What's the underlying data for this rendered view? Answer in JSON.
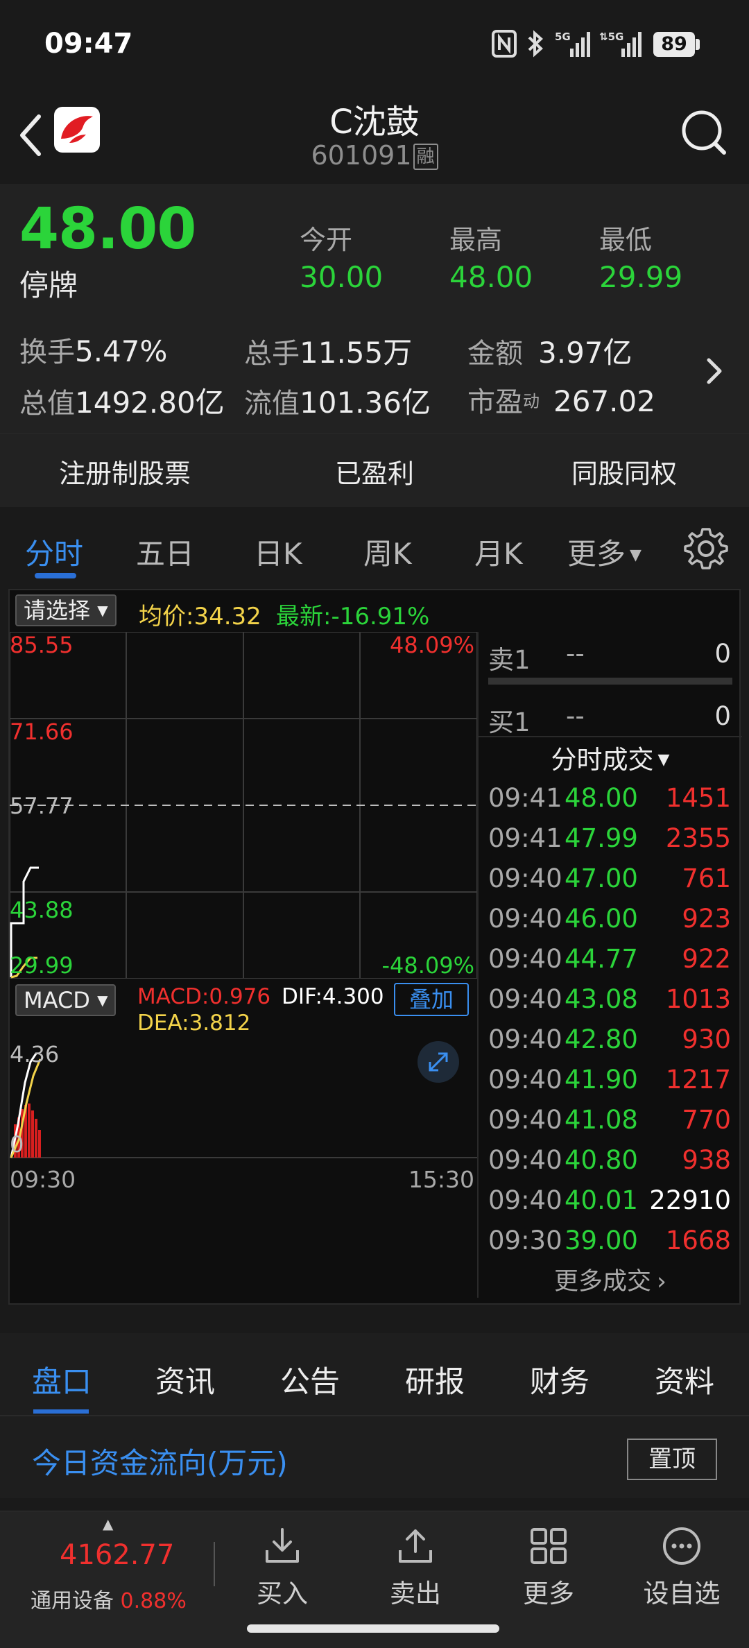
{
  "status_bar": {
    "time": "09:47",
    "battery": "89"
  },
  "header": {
    "name": "C沈鼓",
    "code": "601091",
    "badge": "融"
  },
  "quote": {
    "price": "48.00",
    "status": "停牌",
    "open_label": "今开",
    "open": "30.00",
    "high_label": "最高",
    "high": "48.00",
    "low_label": "最低",
    "low": "29.99",
    "turnover_label": "换手",
    "turnover": "5.47%",
    "volume_label": "总手",
    "volume": "11.55万",
    "amount_label": "金额",
    "amount": "3.97亿",
    "mktcap_label": "总值",
    "mktcap": "1492.80亿",
    "float_label": "流值",
    "float": "101.36亿",
    "pe_label": "市盈",
    "pe_sup": "动",
    "pe": "267.02"
  },
  "tags": [
    "注册制股票",
    "已盈利",
    "同股同权"
  ],
  "chart_tabs": [
    "分时",
    "五日",
    "日K",
    "周K",
    "月K",
    "更多"
  ],
  "chart": {
    "select_label": "请选择",
    "avg_label": "均价:34.32",
    "latest_label": "最新:-16.91%",
    "y_labels": [
      "85.55",
      "71.66",
      "57.77",
      "43.88",
      "29.99"
    ],
    "pct_top": "48.09%",
    "pct_bottom": "-48.09%",
    "macd_select": "MACD",
    "macd_value": "MACD:0.976",
    "dif_value": "DIF:4.300",
    "dea_value": "DEA:3.812",
    "overlay_button": "叠加",
    "macd_top": "4.36",
    "macd_zero": "0",
    "time_start": "09:30",
    "time_end": "15:30"
  },
  "orderbook": {
    "sell1_label": "卖1",
    "sell1_price": "--",
    "sell1_vol": "0",
    "buy1_label": "买1",
    "buy1_price": "--",
    "buy1_vol": "0",
    "trades_title": "分时成交",
    "trades": [
      {
        "time": "09:41",
        "price": "48.00",
        "vol": "1451"
      },
      {
        "time": "09:41",
        "price": "47.99",
        "vol": "2355"
      },
      {
        "time": "09:40",
        "price": "47.00",
        "vol": "761"
      },
      {
        "time": "09:40",
        "price": "46.00",
        "vol": "923"
      },
      {
        "time": "09:40",
        "price": "44.77",
        "vol": "922"
      },
      {
        "time": "09:40",
        "price": "43.08",
        "vol": "1013"
      },
      {
        "time": "09:40",
        "price": "42.80",
        "vol": "930"
      },
      {
        "time": "09:40",
        "price": "41.90",
        "vol": "1217"
      },
      {
        "time": "09:40",
        "price": "41.08",
        "vol": "770"
      },
      {
        "time": "09:40",
        "price": "40.80",
        "vol": "938"
      },
      {
        "time": "09:40",
        "price": "40.01",
        "vol": "22910"
      },
      {
        "time": "09:30",
        "price": "39.00",
        "vol": "1668"
      }
    ],
    "more_trades": "更多成交"
  },
  "info_tabs": [
    "盘口",
    "资讯",
    "公告",
    "研报",
    "财务",
    "资料"
  ],
  "fund_flow": {
    "title": "今日资金流向(万元)",
    "pin_label": "置顶"
  },
  "bottom_nav": {
    "index_value": "4162.77",
    "index_name": "通用设备",
    "index_change": "0.88%",
    "buy": "买入",
    "sell": "卖出",
    "more": "更多",
    "watch": "设自选"
  }
}
